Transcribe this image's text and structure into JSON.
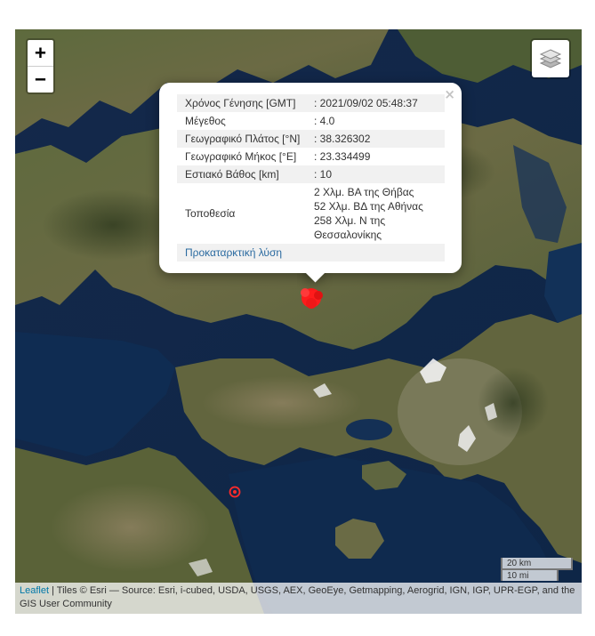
{
  "map": {
    "zoom_in_label": "+",
    "zoom_out_label": "−",
    "layers_icon": "layers-stack-icon",
    "epicenter_color": "#ff1c1c",
    "secondary_marker_color": "#ff2a2a"
  },
  "popup": {
    "close_label": "×",
    "rows": [
      {
        "key": "Χρόνος Γένησης [GMT]",
        "value": ": 2021/09/02 05:48:37"
      },
      {
        "key": "Μέγεθος",
        "value": ": 4.0"
      },
      {
        "key": "Γεωγραφικό Πλάτος [°N]",
        "value": ": 38.326302"
      },
      {
        "key": "Γεωγραφικό Μήκος [°E]",
        "value": ": 23.334499"
      },
      {
        "key": "Εστιακό Βάθος [km]",
        "value": ": 10"
      }
    ],
    "location_key": "Τοποθεσία",
    "location_lines": [
      "2 Χλμ. ΒΑ της Θήβας",
      "52 Χλμ. ΒΔ της Αθήνας",
      "258 Χλμ. Ν της",
      "Θεσσαλονίκης"
    ],
    "link_label": "Προκαταρκτική λύση"
  },
  "scale": {
    "km_label": "20 km",
    "mi_label": "10 mi"
  },
  "attribution": {
    "leaflet_link": "Leaflet",
    "text": " | Tiles © Esri — Source: Esri, i-cubed, USDA, USGS, AEX, GeoEye, Getmapping, Aerogrid, IGN, IGP, UPR-EGP, and the GIS User Community"
  }
}
